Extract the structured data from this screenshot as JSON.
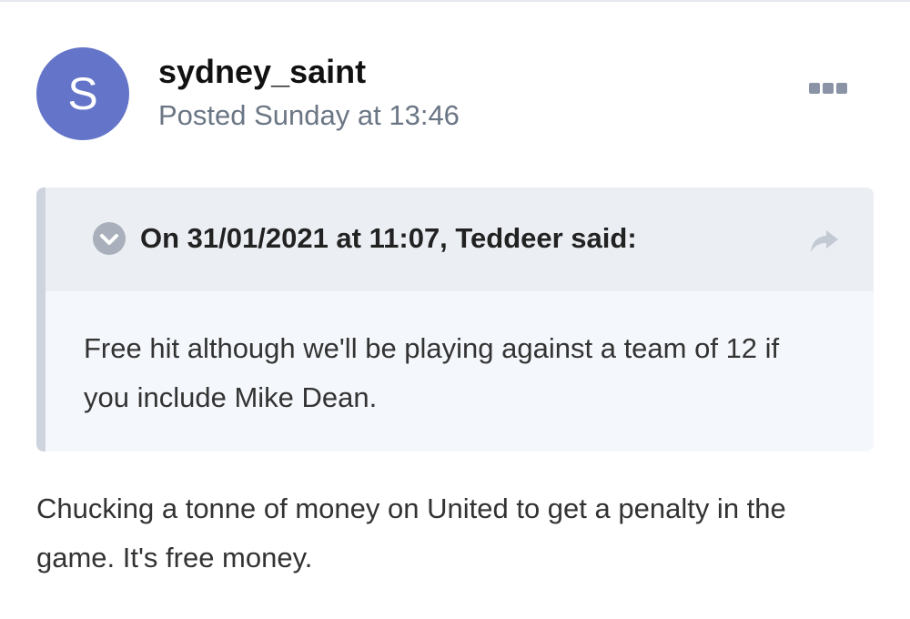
{
  "post": {
    "avatar_letter": "S",
    "author": "sydney_saint",
    "date": "Posted Sunday at 13:46",
    "body": "Chucking a tonne of money on United to get a penalty in the game. It's free money."
  },
  "quote": {
    "citation": "On 31/01/2021 at 11:07, Teddeer said:",
    "text": "Free hit although we'll be playing against a team of 12 if you include Mike Dean."
  },
  "icons": {
    "more": "ellipsis-icon",
    "toggle": "chevron-down-icon",
    "share": "share-arrow-icon"
  },
  "colors": {
    "avatar": "#6474c8",
    "quote_background": "#f4f7fb",
    "quote_header": "#ebeef3",
    "quote_bar": "#ced4dd",
    "muted_text": "#6b7685"
  }
}
